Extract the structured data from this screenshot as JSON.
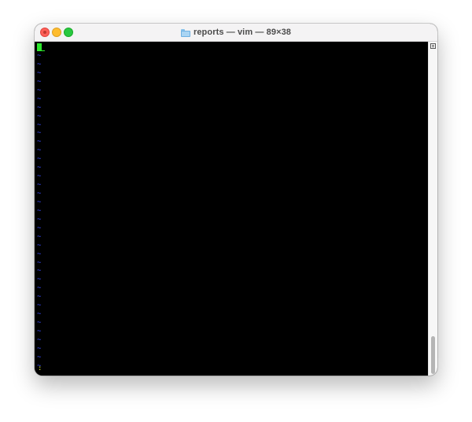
{
  "window": {
    "title": "reports — vim — 89×38",
    "folder_icon": "folder-icon"
  },
  "vim": {
    "empty_line_marker": "~",
    "empty_line_count": 37,
    "command_line": ":",
    "cursor_color": "#2ee82e",
    "tilde_color": "#3b4cff",
    "command_color": "#d8e632"
  },
  "scrollbar": {
    "marks_icon": "marks-icon"
  },
  "colors": {
    "close": "#fe5f57",
    "minimize": "#febc2e",
    "zoom": "#28c840",
    "terminal_bg": "#000000"
  }
}
